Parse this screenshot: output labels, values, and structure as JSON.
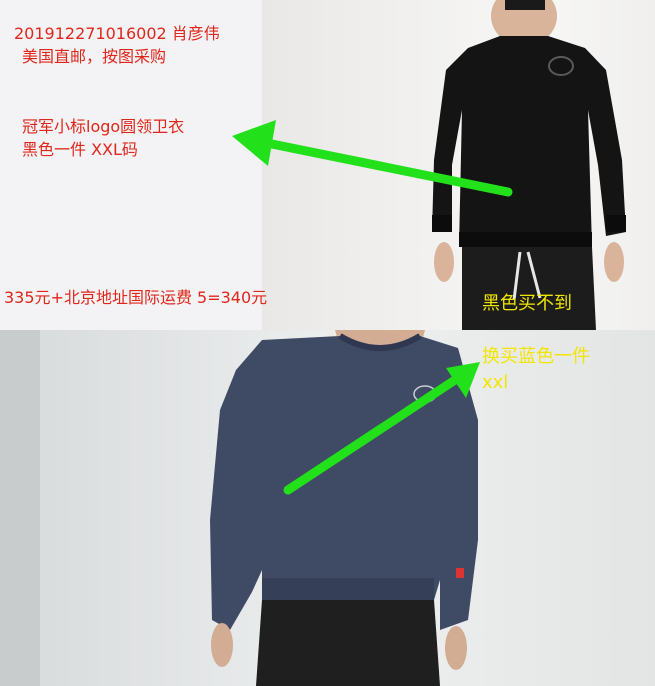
{
  "top_note": {
    "order_line": "201912271016002    肖彦伟",
    "shipping_line": "美国直邮，按图采购",
    "item_line1": "冠军小标logo圆领卫衣",
    "item_line2": "黑色一件 XXL码",
    "price_line": "335元+北京地址国际运费 5=340元"
  },
  "top_photo": {
    "caption": "黑色买不到"
  },
  "bottom_photo": {
    "caption_line1": "换买蓝色一件",
    "caption_line2": "xxl"
  },
  "colors": {
    "note_text": "#e0261a",
    "caption_text": "#f2e600",
    "arrow": "#22e01a",
    "black_sweatshirt": "#141414",
    "navy_sweatshirt": "#3f4a64"
  }
}
